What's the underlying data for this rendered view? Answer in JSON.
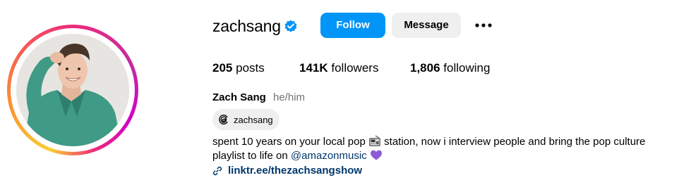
{
  "profile": {
    "username": "zachsang",
    "follow_label": "Follow",
    "message_label": "Message",
    "full_name": "Zach Sang",
    "pronouns": "he/him",
    "threads_handle": "zachsang"
  },
  "stats": {
    "posts_count": "205",
    "posts_label": "posts",
    "followers_count": "141K",
    "followers_label": "followers",
    "following_count": "1,806",
    "following_label": "following"
  },
  "bio": {
    "line1_part1": "spent 10 years on your local pop",
    "line1_part2": "station, now i interview people and bring the pop culture",
    "line2_part1": "playlist to life on",
    "mention": "@amazonmusic",
    "link": "linktr.ee/thezachsangshow"
  },
  "icons": {
    "verified": "verified-badge-icon",
    "more": "more-options-icon",
    "threads": "threads-icon",
    "radio": "radio-emoji-icon",
    "heart": "purple-heart-emoji-icon",
    "link": "link-icon"
  },
  "colors": {
    "accent": "#0095f6",
    "link": "#00376b",
    "secondary_text": "#737373",
    "button_bg": "#efefef",
    "heart": "#8e5bd6"
  }
}
